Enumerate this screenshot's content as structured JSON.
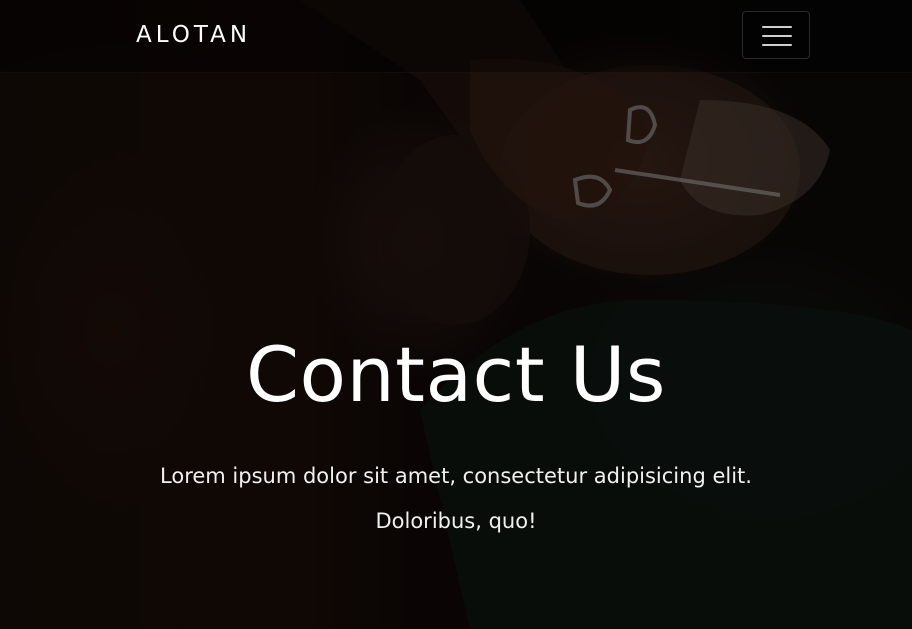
{
  "header": {
    "brand": "ALOTAN",
    "menu_icon": "hamburger-menu-icon"
  },
  "hero": {
    "title": "Contact Us",
    "lead": "Lorem ipsum dolor sit amet, consectetur adipisicing elit. Doloribus, quo!",
    "background_image": "barber-trimming-beard-photo"
  },
  "colors": {
    "text": "#ffffff",
    "overlay": "#000000",
    "toggle_border": "#3a3a3a"
  }
}
